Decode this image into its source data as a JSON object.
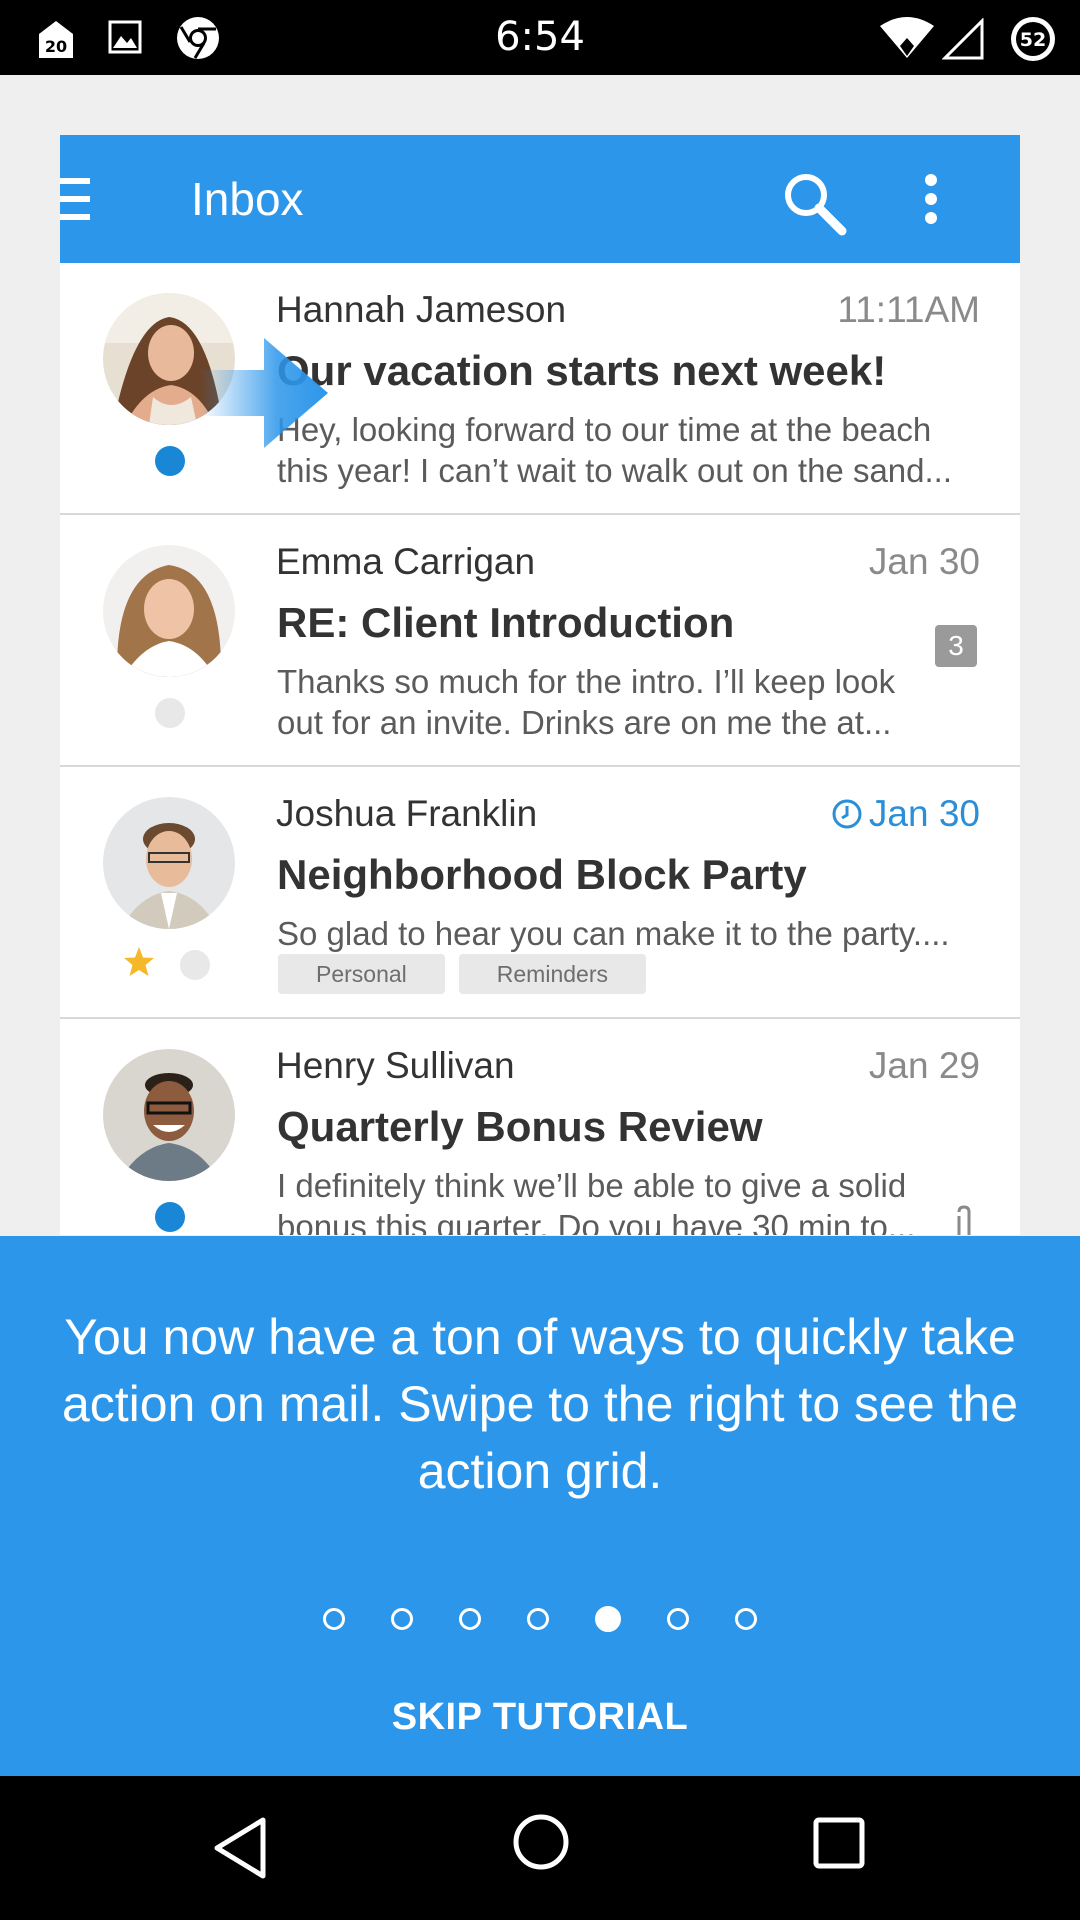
{
  "status_bar": {
    "time": "6:54",
    "notification_badge": "20",
    "battery_level": "52",
    "icons": [
      "notification-icon",
      "gallery-icon",
      "chrome-icon",
      "wifi-icon",
      "cell-signal-icon",
      "battery-icon"
    ]
  },
  "app_bar": {
    "title": "Inbox",
    "icons": [
      "hamburger-menu-icon",
      "search-icon",
      "more-vert-icon"
    ],
    "color": "#2c96ea"
  },
  "emails": [
    {
      "sender": "Hannah Jameson",
      "date": "11:11AM",
      "subject": "Our vacation starts next week!",
      "preview": "Hey, looking forward to our time at the beach this year! I can’t wait to walk out on the sand...",
      "unread": true
    },
    {
      "sender": "Emma Carrigan",
      "date": "Jan 30",
      "subject": "RE: Client Introduction",
      "preview": "Thanks so much for the intro. I’ll keep look out for an invite. Drinks are on me the at...",
      "count": "3",
      "unread": false
    },
    {
      "sender": "Joshua Franklin",
      "date": "Jan 30",
      "reminder": true,
      "subject": "Neighborhood Block Party",
      "preview": "So glad to hear you can make it to the party....",
      "tags": [
        "Personal",
        "Reminders"
      ],
      "starred": true,
      "unread": false
    },
    {
      "sender": "Henry Sullivan",
      "date": "Jan 29",
      "subject": "Quarterly Bonus Review",
      "preview": "I definitely think we’ll be able to give a solid bonus this quarter. Do you have 30 min to...",
      "attachment": true,
      "unread": true
    }
  ],
  "tutorial": {
    "message": "You now have a ton of ways to quickly take action on mail. Swipe to the right to see the action grid.",
    "page_count": 7,
    "active_page": 5,
    "skip_label": "SKIP TUTORIAL"
  },
  "nav_bar": {
    "icons": [
      "back-icon",
      "home-icon",
      "recents-icon"
    ]
  }
}
